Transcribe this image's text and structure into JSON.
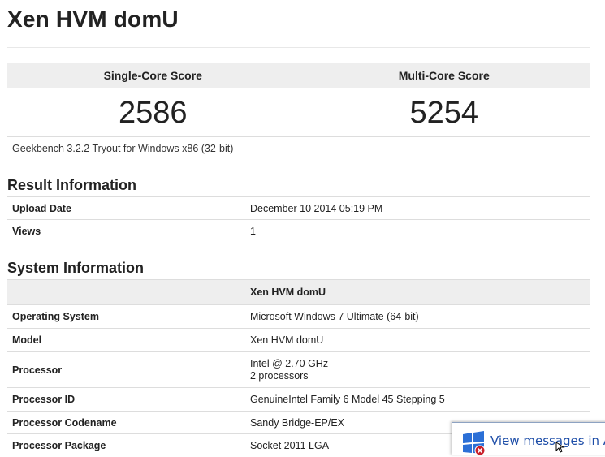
{
  "title": "Xen HVM domU",
  "scores": {
    "single_label": "Single-Core Score",
    "multi_label": "Multi-Core Score",
    "single_value": "2586",
    "multi_value": "5254"
  },
  "version": "Geekbench 3.2.2 Tryout for Windows x86 (32-bit)",
  "result_info": {
    "heading": "Result Information",
    "rows": [
      {
        "key": "Upload Date",
        "value": "December 10 2014 05:19 PM"
      },
      {
        "key": "Views",
        "value": "1"
      }
    ]
  },
  "system_info": {
    "heading": "System Information",
    "header_value": "Xen HVM domU",
    "rows": [
      {
        "key": "Operating System",
        "value": "Microsoft Windows 7 Ultimate (64-bit)"
      },
      {
        "key": "Model",
        "value": "Xen HVM domU"
      },
      {
        "key": "Processor",
        "value": "Intel @ 2.70 GHz",
        "value2": "2 processors"
      },
      {
        "key": "Processor ID",
        "value": "GenuineIntel Family 6 Model 45 Stepping 5"
      },
      {
        "key": "Processor Codename",
        "value": "Sandy Bridge-EP/EX"
      },
      {
        "key": "Processor Package",
        "value": "Socket 2011 LGA"
      }
    ]
  },
  "notification": {
    "text": "View messages in Ac",
    "icon": "windows-flag-icon"
  },
  "colors": {
    "header_bg": "#eeeeee",
    "rule": "#dddddd",
    "link_blue": "#1e4ea8"
  }
}
